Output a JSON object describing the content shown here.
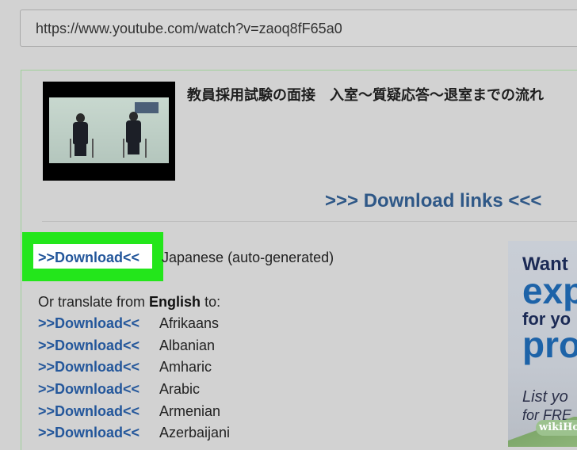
{
  "address_bar": {
    "url": "https://www.youtube.com/watch?v=zaoq8fF65a0"
  },
  "video": {
    "title": "教員採用試験の面接　入室～質疑応答～退室までの流れ"
  },
  "download_heading": ">>> Download links <<<",
  "primary": {
    "link": ">>Download<<",
    "language": "Japanese (auto-generated)"
  },
  "translate": {
    "prefix": "Or translate from ",
    "source_language": "English",
    "suffix": " to:"
  },
  "translations": [
    {
      "link": ">>Download<<",
      "language": "Afrikaans"
    },
    {
      "link": ">>Download<<",
      "language": "Albanian"
    },
    {
      "link": ">>Download<<",
      "language": "Amharic"
    },
    {
      "link": ">>Download<<",
      "language": "Arabic"
    },
    {
      "link": ">>Download<<",
      "language": "Armenian"
    },
    {
      "link": ">>Download<<",
      "language": "Azerbaijani"
    }
  ],
  "ad": {
    "line1": "Want",
    "line2": "exp",
    "line3": "for yo",
    "line4": "pro",
    "line5": "List yo",
    "line6": "for FRE"
  },
  "watermark": "wikiHow",
  "colors": {
    "highlight": "#23e61b",
    "link": "#24579b",
    "heading": "#2f5887"
  }
}
